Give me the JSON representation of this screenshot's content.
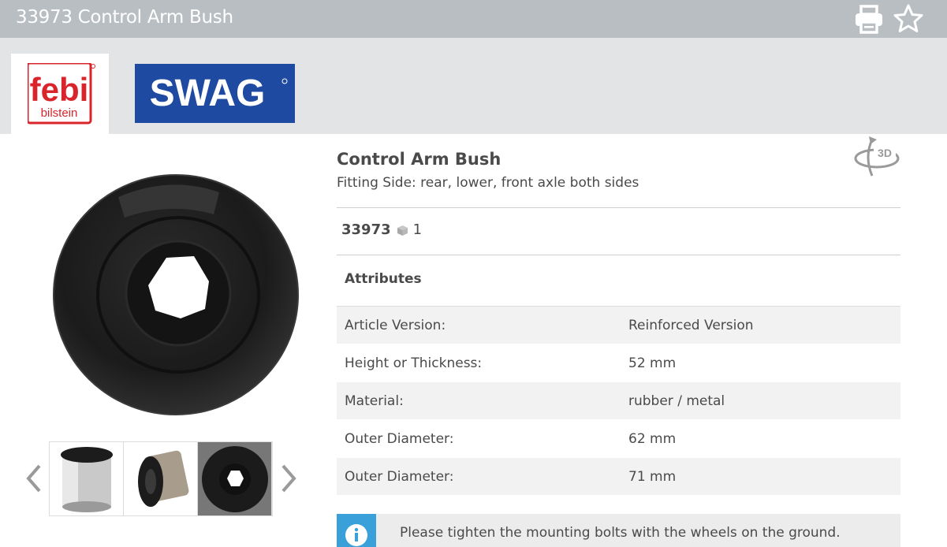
{
  "header": {
    "title": "33973 Control Arm Bush",
    "print_icon": "print-icon",
    "favorite_icon": "star-icon"
  },
  "brands": {
    "febi": {
      "line1": "febi",
      "line2": "bilstein",
      "color": "#d9242b"
    },
    "swag": {
      "label": "SWAG",
      "color": "#1e4aa1"
    }
  },
  "product": {
    "name": "Control Arm Bush",
    "fitting": "Fitting Side: rear, lower, front axle both sides",
    "article_number": "33973",
    "quantity": "1",
    "view_3d_icon": "3d-rotate-icon"
  },
  "attributes": {
    "heading": "Attributes",
    "rows": [
      {
        "key": "Article Version:",
        "value": "Reinforced Version"
      },
      {
        "key": "Height or Thickness:",
        "value": "52 mm"
      },
      {
        "key": "Material:",
        "value": "rubber / metal"
      },
      {
        "key": "Outer Diameter:",
        "value": "62 mm"
      },
      {
        "key": "Outer Diameter:",
        "value": "71 mm"
      }
    ]
  },
  "notice": {
    "text": "Please tighten the mounting bolts with the wheels on the ground.",
    "icon": "info-icon",
    "color": "#3aa0d9"
  },
  "gallery": {
    "active_index": 2,
    "count": 3
  }
}
